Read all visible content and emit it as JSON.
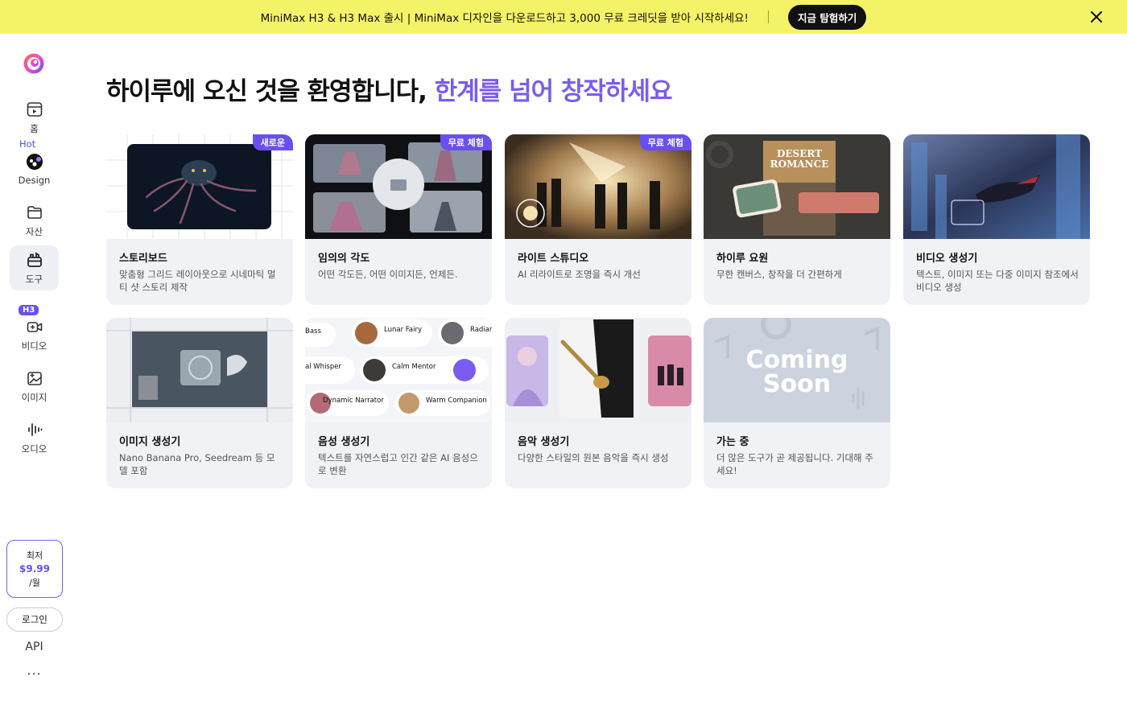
{
  "banner": {
    "text": "MiniMax H3 & H3 Max 출시 | MiniMax 디자인을 다운로드하고 3,000 무료 크레딧을 받아 시작하세요!",
    "button": "지금 탐험하기"
  },
  "sidebar": {
    "hot_tag": "Hot",
    "h3_badge": "H3",
    "items": [
      {
        "label": "홈",
        "icon": "home-icon"
      },
      {
        "label": "Design",
        "icon": "design-icon"
      },
      {
        "label": "자산",
        "icon": "folder-icon"
      },
      {
        "label": "도구",
        "icon": "toolbox-icon"
      },
      {
        "label": "비디오",
        "icon": "video-icon"
      },
      {
        "label": "이미지",
        "icon": "image-icon"
      },
      {
        "label": "오디오",
        "icon": "audio-icon"
      }
    ],
    "price": {
      "top": "최저",
      "amount": "$9.99",
      "unit": "/월"
    },
    "login": "로그인",
    "api": "API",
    "more": "···"
  },
  "main": {
    "headline_plain": "하이루에 오신 것을 환영합니다, ",
    "headline_accent": "한계를 넘어 창작하세요"
  },
  "cards": [
    {
      "title": "스토리보드",
      "desc": "맞춤형 그리드 레이아웃으로 시네마틱 멀티 샷 스토리 제작",
      "badge": "새로운"
    },
    {
      "title": "임의의 각도",
      "desc": "어떤 각도든, 어떤 이미지든, 언제든.",
      "badge": "무료 체험"
    },
    {
      "title": "라이트 스튜디오",
      "desc": "AI 리라이트로 조명을 즉시 개선",
      "badge": "무료 체험"
    },
    {
      "title": "하이루 요원",
      "desc": "무한 캔버스, 창작을 더 간편하게",
      "badge": ""
    },
    {
      "title": "비디오 생성기",
      "desc": "텍스트, 이미지 또는 다중 이미지 참조에서 비디오 생성",
      "badge": ""
    },
    {
      "title": "이미지 생성기",
      "desc": "Nano Banana Pro, Seedream 등 모델 포함",
      "badge": ""
    },
    {
      "title": "음성 생성기",
      "desc": "텍스트를 자연스럽고 인간 같은 AI 음성으로 변환",
      "badge": ""
    },
    {
      "title": "음악 생성기",
      "desc": "다양한 스타일의 원본 음악을 즉시 생성",
      "badge": ""
    },
    {
      "title": "가는 중",
      "desc": "더 많은 도구가 곧 제공됩니다. 기대해 주세요!",
      "badge": ""
    }
  ],
  "thumb_text": {
    "desert_romance": "DESERT ROMANCE",
    "coming_soon": "Coming Soon",
    "voices": [
      {
        "name": "Bass"
      },
      {
        "name": "Lunar Fairy"
      },
      {
        "name": "Radiar"
      },
      {
        "name": "al Whisper"
      },
      {
        "name": "Calm Mentor"
      },
      {
        "name": "Dynamic Narrator"
      },
      {
        "name": "Warm Companion"
      }
    ]
  },
  "colors": {
    "banner": "#f4f266",
    "accent": "#7a5cf0",
    "badge": "#6a4ff0",
    "card": "#f1f2f6"
  }
}
